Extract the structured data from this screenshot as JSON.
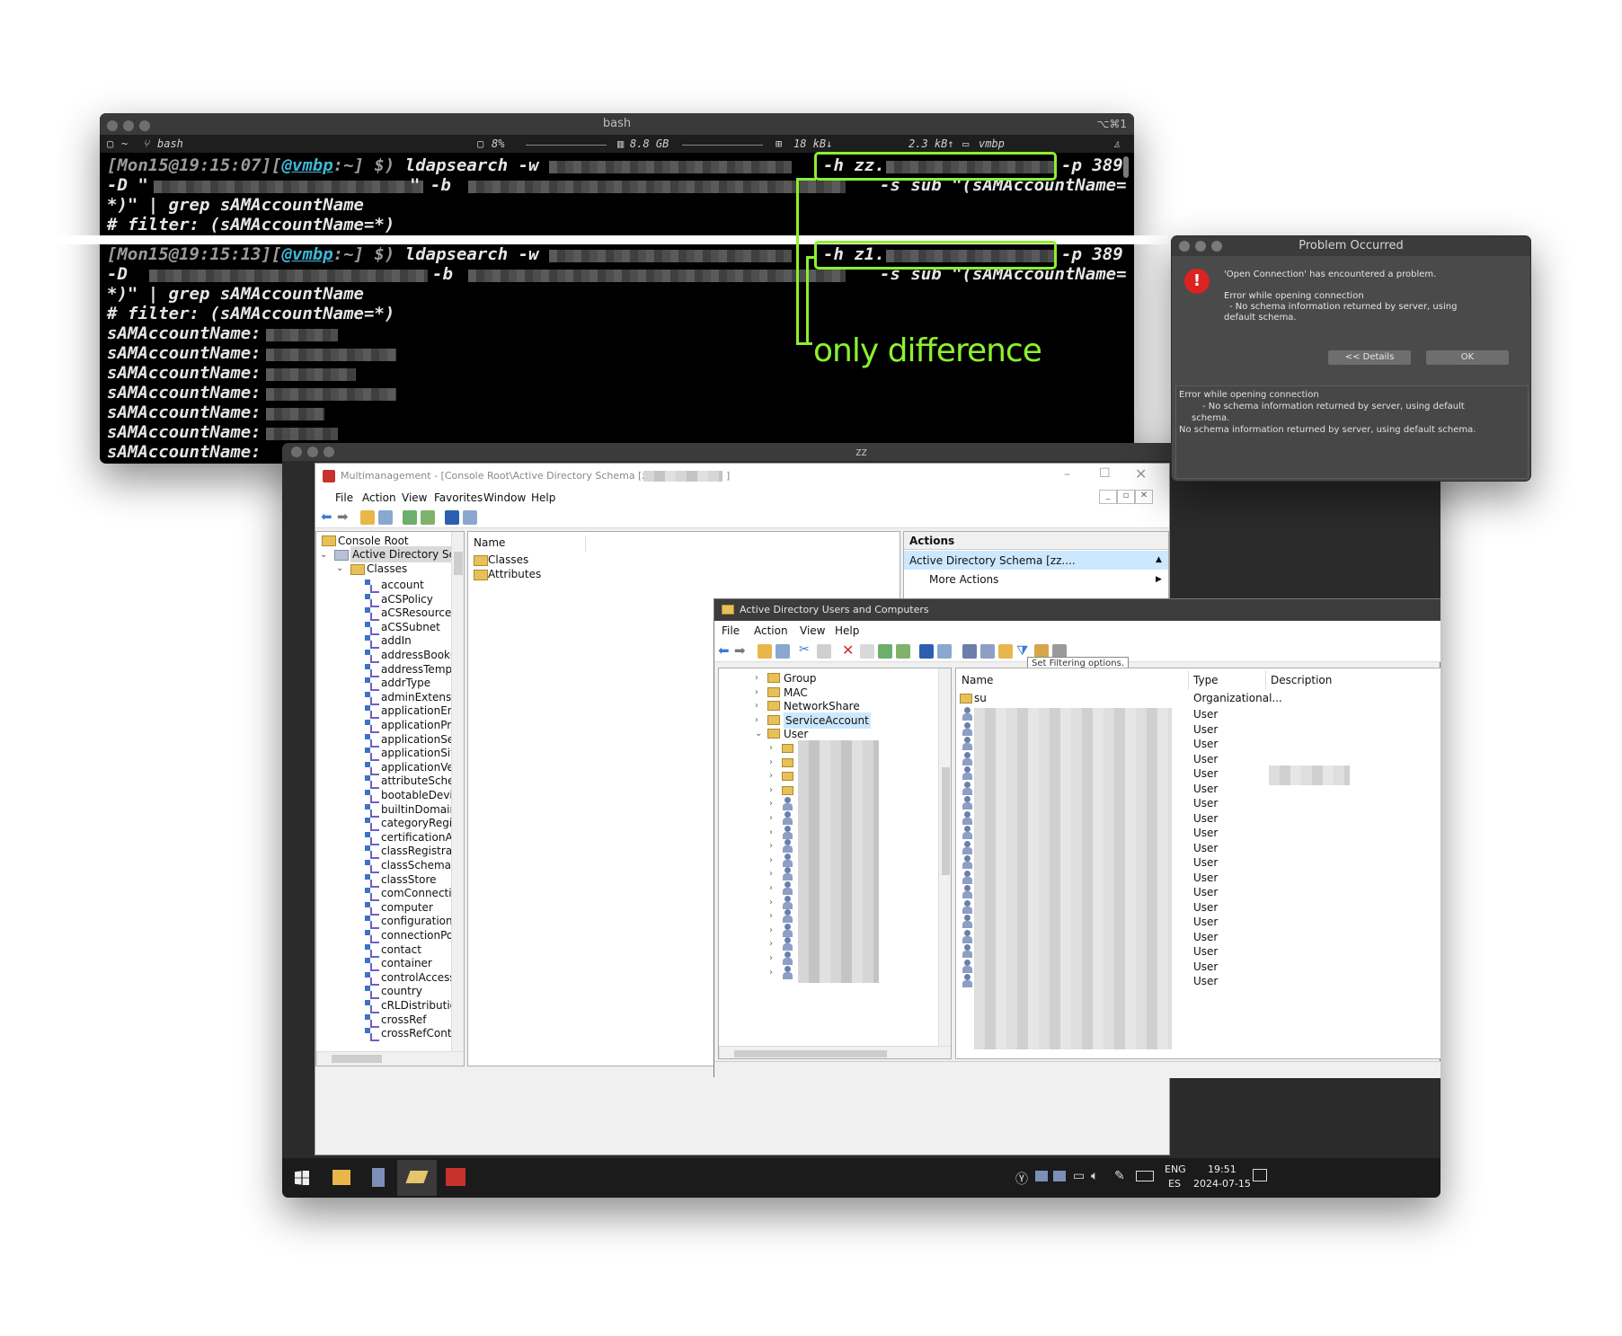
{
  "terminal": {
    "title": "bash",
    "shortcut": "⌥⌘1",
    "status": {
      "dir": "~",
      "shell": "bash",
      "cpu": "8%",
      "mem": "8.8 GB",
      "net_down": "18 kB↓",
      "net_up": "2.3 kB↑",
      "host": "vmbp"
    },
    "block1": {
      "prompt_time": "[Mon15@19:15:07][",
      "prompt_host": "@vmbp",
      "prompt_tail": ":~] $)",
      "cmd": "ldapsearch -w",
      "hflag": "-h zz.",
      "port": "-p 389",
      "line2_d": "-D \"",
      "line2_b": "\" -b",
      "line2_s": "-s sub \"(sAMAccountName=",
      "line3": "*)\" | grep sAMAccountName",
      "line4": "# filter: (sAMAccountName=*)"
    },
    "block2": {
      "prompt_time": "[Mon15@19:15:13][",
      "prompt_host": "@vmbp",
      "prompt_tail": ":~] $)",
      "cmd": "ldapsearch -w",
      "hflag": "-h z1.",
      "port": "-p 389",
      "line2_d": "-D",
      "line2_b": "-b",
      "line2_s": "-s sub \"(sAMAccountName=",
      "line3": "*)\" | grep sAMAccountName",
      "line4": "# filter: (sAMAccountName=*)"
    },
    "result_label": "sAMAccountName:",
    "annotation": "only difference"
  },
  "problem_dialog": {
    "title": "Problem Occurred",
    "message": "'Open Connection' has encountered a problem.",
    "detail1": "Error while opening connection",
    "detail2": "- No schema information returned by server, using",
    "detail3": "default schema.",
    "details_button": "<< Details",
    "ok_button": "OK",
    "details_text": [
      "Error while opening connection",
      "- No schema information returned by server, using default",
      "schema.",
      "No schema information returned by server, using default schema."
    ]
  },
  "vm": {
    "title": "zz",
    "mmc": {
      "title": "Multimanagement - [Console Root\\Active Directory Schema [zz.",
      "title_end": "]",
      "menu": [
        "File",
        "Action",
        "View",
        "Favorites",
        "Window",
        "Help"
      ],
      "tree": {
        "root": "Console Root",
        "schema": "Active Directory Schema",
        "classes": "Classes",
        "items": [
          "account",
          "aCSPolicy",
          "aCSResourceLimi",
          "aCSSubnet",
          "addIn",
          "addressBookCon",
          "addressTemplate",
          "addrType",
          "adminExtension",
          "applicationEntity",
          "applicationProce",
          "applicationSettin",
          "applicationSiteSe",
          "applicationVersio",
          "attributeSchema",
          "bootableDevice",
          "builtinDomain",
          "categoryRegistrat",
          "certificationAuth",
          "classRegistration",
          "classSchema",
          "classStore",
          "comConnectionP",
          "computer",
          "configuration",
          "connectionPoint",
          "contact",
          "container",
          "controlAccessRig",
          "country",
          "cRLDistributionP",
          "crossRef",
          "crossRefContaine"
        ]
      },
      "center": {
        "header": "Name",
        "items": [
          "Classes",
          "Attributes"
        ]
      },
      "actions": {
        "header": "Actions",
        "selected": "Active Directory Schema [zz....",
        "more": "More Actions"
      }
    },
    "aduc": {
      "title": "Active Directory Users and Computers",
      "menu": [
        "File",
        "Action",
        "View",
        "Help"
      ],
      "tooltip": "Set Filtering options.",
      "tree": [
        "Group",
        "MAC",
        "NetworkShare",
        "ServiceAccount",
        "User"
      ],
      "columns": [
        "Name",
        "Type",
        "Description"
      ],
      "first_row": {
        "name": "su",
        "type": "Organizational..."
      },
      "user_type": "User",
      "user_rows": 19
    },
    "taskbar": {
      "lang1": "ENG",
      "lang2": "ES",
      "time": "19:51",
      "date": "2024-07-15"
    }
  },
  "colors": {
    "highlight_green": "#8cf02e",
    "terminal_bg": "#000000",
    "selection_blue": "#cce8ff"
  }
}
